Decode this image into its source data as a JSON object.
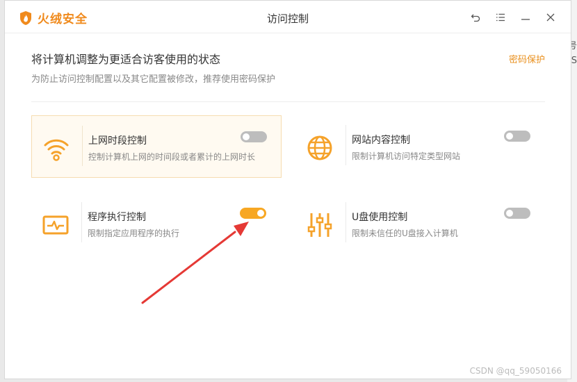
{
  "app": {
    "name": "火绒安全",
    "window_title": "访问控制",
    "brand_color": "#f08a1c"
  },
  "header": {
    "title": "将计算机调整为更适合访客使用的状态",
    "subtitle": "为防止访问控制配置以及其它配置被修改，推荐使用密码保护",
    "password_link": "密码保护"
  },
  "window_controls": [
    "back-icon",
    "menu-icon",
    "minimize-icon",
    "close-icon"
  ],
  "cards": [
    {
      "title": "上网时段控制",
      "desc": "控制计算机上网的时间段或者累计的上网时长",
      "icon": "wifi-icon",
      "enabled": false
    },
    {
      "title": "网站内容控制",
      "desc": "限制计算机访问特定类型网站",
      "icon": "globe-icon",
      "enabled": false
    },
    {
      "title": "程序执行控制",
      "desc": "限制指定应用程序的执行",
      "icon": "monitor-pulse-icon",
      "enabled": true
    },
    {
      "title": "U盘使用控制",
      "desc": "限制未信任的U盘接入计算机",
      "icon": "sliders-icon",
      "enabled": false
    }
  ],
  "background_text": {
    "a": "号",
    "b": "S"
  },
  "watermark": "CSDN @qq_59050166",
  "colors": {
    "accent": "#f7a723",
    "toggle_off": "#bdbdbd",
    "annotation_arrow": "#e53935"
  }
}
